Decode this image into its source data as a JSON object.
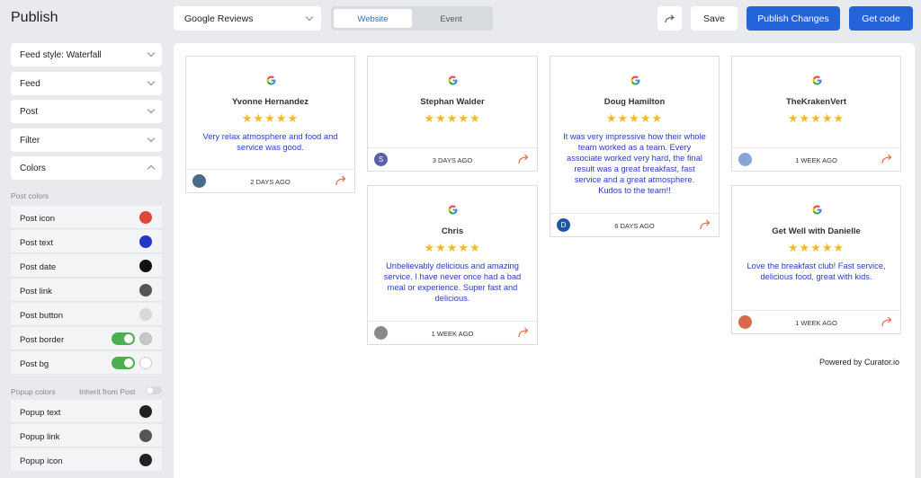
{
  "header": {
    "title": "Publish",
    "source_select": "Google Reviews",
    "tabs": [
      "Website",
      "Event"
    ],
    "save": "Save",
    "publish": "Publish Changes",
    "get_code": "Get code"
  },
  "sidebar": {
    "accordions": [
      "Feed style: Waterfall",
      "Feed",
      "Post",
      "Filter",
      "Colors"
    ],
    "post_colors_label": "Post colors",
    "post_colors": [
      {
        "label": "Post icon",
        "color": "#e0453a"
      },
      {
        "label": "Post text",
        "color": "#2238c8"
      },
      {
        "label": "Post date",
        "color": "#111111"
      },
      {
        "label": "Post link",
        "color": "#555555"
      },
      {
        "label": "Post button",
        "color": "#d9d9d9"
      },
      {
        "label": "Post border",
        "color": "#c8c8c8"
      },
      {
        "label": "Post bg",
        "color": "#ffffff"
      }
    ],
    "popup_colors_label": "Popup colors",
    "inherit_label": "Inherit from Post",
    "popup_colors": [
      {
        "label": "Popup text",
        "color": "#222222"
      },
      {
        "label": "Popup link",
        "color": "#555555"
      },
      {
        "label": "Popup icon",
        "color": "#222222"
      }
    ]
  },
  "posts": [
    {
      "name": "Yvonne Hernandez",
      "text": "Very relax atmosphere and food and service was good.",
      "date": "2 DAYS AGO",
      "avatar": "#4a6a8a"
    },
    {
      "name": "Stephan Walder",
      "text": "",
      "date": "3 DAYS AGO",
      "avatar": "#5b5ea8",
      "initial": "S"
    },
    {
      "name": "Chris",
      "text": "Unbelievably delicious and amazing service. I have never once had a bad meal or experience. Super fast and delicious.",
      "date": "1 WEEK AGO",
      "avatar": "#8a8a8a"
    },
    {
      "name": "Doug Hamilton",
      "text": "It was very impressive how their whole team worked as a team. Every associate worked very hard, the final result was a great breakfast, fast service and a great atmosphere. Kudos to the team!!",
      "date": "6 DAYS AGO",
      "avatar": "#1f57a8",
      "initial": "D"
    },
    {
      "name": "TheKrakenVert",
      "text": "",
      "date": "1 WEEK AGO",
      "avatar": "#8aa6d8"
    },
    {
      "name": "Get Well with Danielle",
      "text": "Love the breakfast club! Fast service, delicious food, great with kids.",
      "date": "1 WEEK AGO",
      "avatar": "#d66a4a"
    }
  ],
  "stars": "★★★★★",
  "powered": "Powered by Curator.io",
  "colors": {
    "accent": "#2563d9",
    "star": "#f5b926",
    "post_text": "#2a3cc4",
    "share_arrow": "#e8684a"
  }
}
